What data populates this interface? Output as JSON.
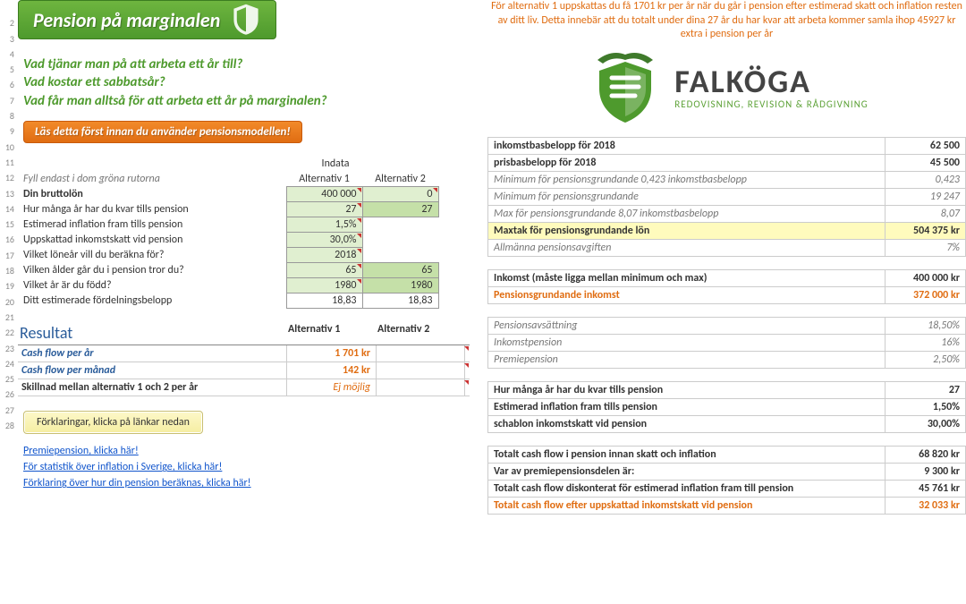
{
  "banner": {
    "title": "Pension på marginalen"
  },
  "questions": [
    "Vad tjänar man på att arbeta ett år till?",
    "Vad kostar ett sabbatsår?",
    "Vad får man alltså för att arbeta ett år på marginalen?"
  ],
  "read_first": "Läs detta först innan du använder pensionsmodellen!",
  "top_note": "För alternativ 1 uppskattas du få 1701 kr per år när du går i pension efter estimerad skatt och inflation resten av ditt liv. Detta innebär att du totalt under dina 27 år du har kvar att arbeta kommer samla ihop 45927 kr extra i pension per år",
  "logo": {
    "name": "FALKÖGA",
    "sub": "REDOVISNING, REVISION & RÅDGIVNING"
  },
  "indata": {
    "title": "Indata",
    "hint": "Fyll endast i dom gröna rutorna",
    "col1": "Alternativ 1",
    "col2": "Alternativ 2",
    "rows": [
      {
        "label": "Din bruttolön",
        "bold": true,
        "v1": "400 000",
        "v2": "0",
        "green": true
      },
      {
        "label": "Hur många år har du kvar tills pension",
        "v1": "27",
        "v2": "27",
        "green": true,
        "lock2": true
      },
      {
        "label": "Estimerad inflation fram tills pension",
        "v1": "1,5%",
        "green": true,
        "single": true
      },
      {
        "label": "Uppskattad inkomstskatt vid pension",
        "v1": "30,0%",
        "green": true,
        "single": true
      },
      {
        "label": "Vilket löneår vill du beräkna för?",
        "v1": "2018",
        "green": true,
        "single": true
      },
      {
        "label": "Vilken ålder går du i pension tror du?",
        "v1": "65",
        "v2": "65",
        "green": true,
        "lock2": true
      },
      {
        "label": "Vilket år är du född?",
        "v1": "1980",
        "v2": "1980",
        "green": true,
        "lock2": true
      },
      {
        "label": "Ditt estimerade fördelningsbelopp",
        "v1": "18,83",
        "v2": "18,83",
        "plain": true
      }
    ]
  },
  "result": {
    "title": "Resultat",
    "col1": "Alternativ 1",
    "col2": "Alternativ 2",
    "rows": [
      {
        "label": "Cash flow per år",
        "v1": "1 701 kr"
      },
      {
        "label": "Cash flow per månad",
        "v1": "142 kr"
      }
    ],
    "diff_label": "Skillnad mellan alternativ 1 och 2 per år",
    "diff_value": "Ej möjlig"
  },
  "explain_btn": "Förklaringar, klicka på länkar nedan",
  "links": [
    "Premiepension, klicka här!",
    "För statistik över inflation i Sverige, klicka här!",
    "Förklaring över hur din pension beräknas, klicka här!"
  ],
  "right_top": [
    {
      "l": "inkomstbasbelopp för 2018",
      "v": "62 500",
      "bold": true
    },
    {
      "l": "prisbasbelopp för 2018",
      "v": "45 500",
      "bold": true
    },
    {
      "l": "Minimum för pensionsgrundande 0,423 inkomstbasbelopp",
      "v": "0,423",
      "ital": true
    },
    {
      "l": "Minimum för pensionsgrundande",
      "v": "19 247",
      "ital": true
    },
    {
      "l": "Max för pensionsgrundande 8,07 inkomstbasbelopp",
      "v": "8,07",
      "ital": true
    },
    {
      "l": "Maxtak för pensionsgrundande lön",
      "v": "504 375 kr",
      "bold": true,
      "hl": true
    },
    {
      "l": "Allmänna pensionsavgiften",
      "v": "7%",
      "ital": true
    }
  ],
  "right_income": [
    {
      "l": "Inkomst (måste ligga mellan minimum och max)",
      "v": "400 000 kr",
      "bold": true
    },
    {
      "l": "Pensionsgrundande inkomst",
      "v": "372 000 kr",
      "orange": true
    }
  ],
  "right_percents": [
    {
      "l": "Pensionsavsättning",
      "v": "18,50%"
    },
    {
      "l": "Inkomstpension",
      "v": "16%"
    },
    {
      "l": "Premiepension",
      "v": "2,50%"
    }
  ],
  "right_years": [
    {
      "l": "Hur många år har du kvar tills pension",
      "v": "27"
    },
    {
      "l": "Estimerad inflation fram tills pension",
      "v": "1,50%"
    },
    {
      "l": "schablon inkomstskatt vid pension",
      "v": "30,00%"
    }
  ],
  "right_totals": [
    {
      "l_pre": "Totalt cash flow i pension ",
      "l_b": "innan",
      "l_post": " skatt och inflation",
      "v": "68 820 kr"
    },
    {
      "l": "Var av premiepensionsdelen är:",
      "v": "9 300 kr"
    },
    {
      "l": "Totalt cash flow diskonterat för estimerad inflation fram till pension",
      "v": "45 761 kr"
    },
    {
      "l": "Totalt cash flow efter uppskattad inkomstskatt vid pension",
      "v": "32 033 kr",
      "orange": true
    }
  ]
}
